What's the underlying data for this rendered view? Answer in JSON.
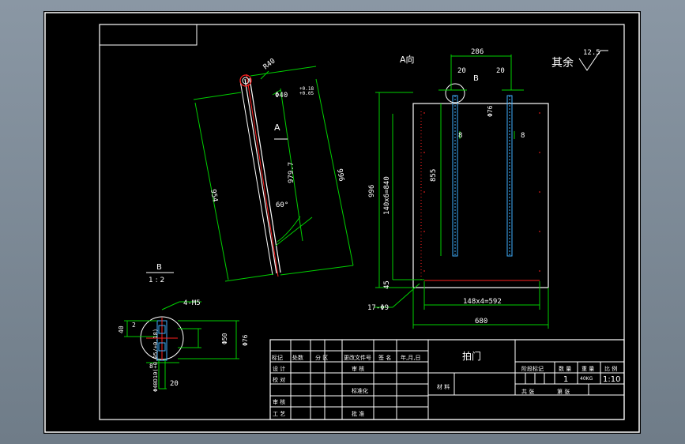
{
  "colors": {
    "background": "#000000",
    "frame": "#ffffff",
    "dimension": "#00d000",
    "centerline": "#ff2020",
    "hatch": "#40b0ff"
  },
  "left_view": {
    "r40": "R40",
    "tol_upper": "+0.18",
    "tol_lower": "+0.05",
    "phi40": "Φ40",
    "section_a": "A",
    "dim_954": "954",
    "dim_979": "979.7",
    "dim_996": "996",
    "angle": "60°"
  },
  "a_view": {
    "title": "A向",
    "dim_286": "286",
    "dim_20_left": "20",
    "dim_20_right": "20",
    "detail_b": "B",
    "phi76": "Φ76",
    "dim_8_left": "8",
    "dim_8_right": "8",
    "dim_855": "855",
    "dim_996": "996",
    "dim_140x6": "140x6=840",
    "dim_45": "45",
    "holes": "17-Φ9",
    "dim_148x4": "148x4=592",
    "dim_680": "680"
  },
  "roughness": {
    "text": "其余",
    "value": "12.5"
  },
  "detail_b": {
    "label": "B",
    "scale": "1 : 2",
    "bolts": "4-M5",
    "dim_40": "40",
    "dim_2": "2",
    "dim_8": "8",
    "dim_20": "20",
    "phi50": "Φ50",
    "phi76": "Φ76",
    "phi40d10": "Φ40D10(+0.05/+0.18)"
  },
  "title_block": {
    "part_name": "拍门",
    "headers": [
      "标记",
      "处数",
      "分 区",
      "更改文件号",
      "签 名",
      "年,月,日"
    ],
    "rows_left": [
      "设 计",
      "校 对",
      "审 核",
      "工 艺"
    ],
    "rows_mid": [
      "标准化",
      "批 准"
    ],
    "rows_mid2": [
      "审 核"
    ],
    "side": [
      "材 料"
    ],
    "stage_mark": "阶段标记",
    "quantity_label": "数 量",
    "weight_label": "重 量",
    "scale_label": "比 例",
    "quantity": "1",
    "weight": "40KG",
    "scale": "1:10",
    "sheets_total": "共 张",
    "sheet_no": "第 张"
  }
}
